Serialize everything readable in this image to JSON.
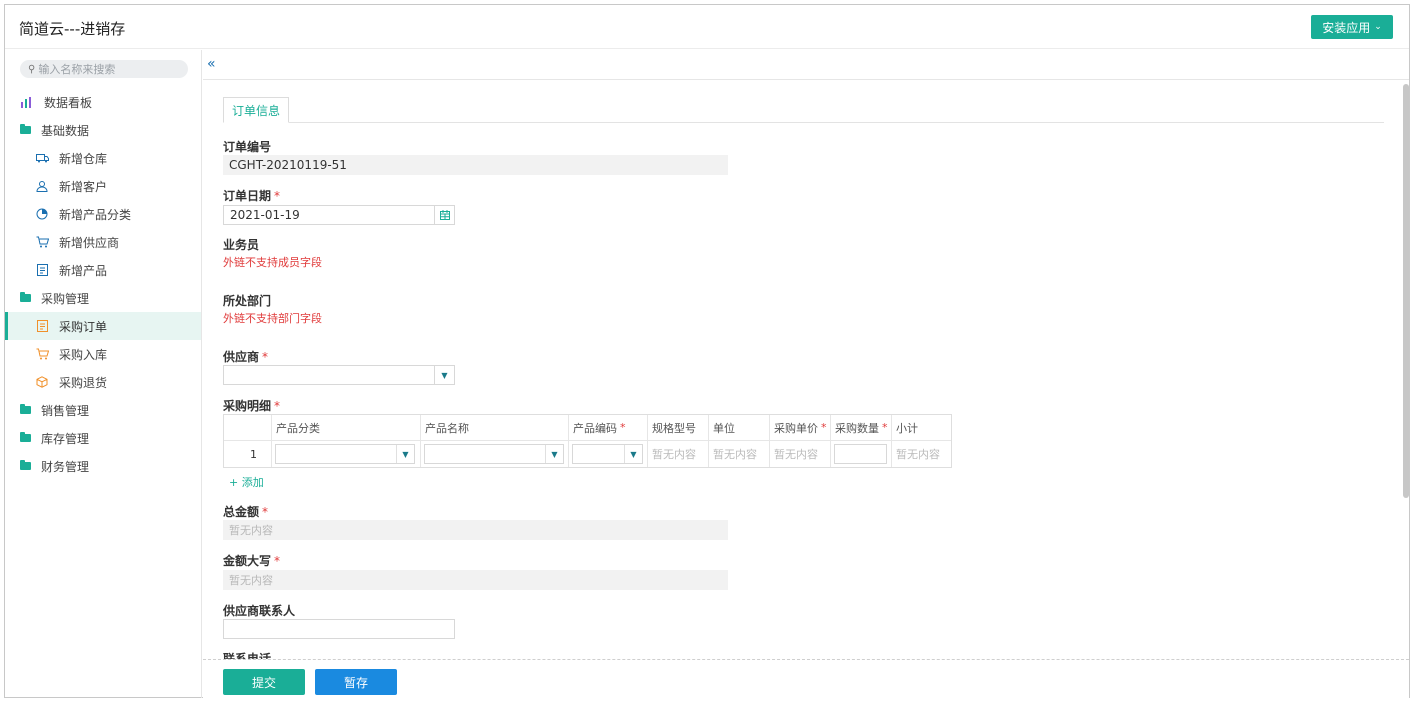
{
  "header": {
    "title": "简道云---进销存",
    "install_label": "安装应用"
  },
  "sidebar": {
    "search_placeholder": "输入名称来搜索",
    "items": [
      {
        "label": "数据看板",
        "icon": "bar-chart-icon"
      },
      {
        "label": "基础数据",
        "icon": "folder-icon"
      },
      {
        "label": "新增仓库",
        "icon": "truck-icon"
      },
      {
        "label": "新增客户",
        "icon": "user-icon"
      },
      {
        "label": "新增产品分类",
        "icon": "pie-chart-icon"
      },
      {
        "label": "新增供应商",
        "icon": "cart-icon"
      },
      {
        "label": "新增产品",
        "icon": "document-icon"
      },
      {
        "label": "采购管理",
        "icon": "folder-icon"
      },
      {
        "label": "采购订单",
        "icon": "order-icon",
        "active": true
      },
      {
        "label": "采购入库",
        "icon": "cart-icon"
      },
      {
        "label": "采购退货",
        "icon": "box-icon"
      },
      {
        "label": "销售管理",
        "icon": "folder-icon"
      },
      {
        "label": "库存管理",
        "icon": "folder-icon"
      },
      {
        "label": "财务管理",
        "icon": "folder-icon"
      }
    ]
  },
  "form": {
    "tab_label": "订单信息",
    "order_no": {
      "label": "订单编号",
      "value": "CGHT-20210119-51"
    },
    "order_date": {
      "label": "订单日期",
      "required": "*",
      "value": "2021-01-19"
    },
    "salesperson": {
      "label": "业务员",
      "warning": "外链不支持成员字段"
    },
    "department": {
      "label": "所处部门",
      "warning": "外链不支持部门字段"
    },
    "supplier": {
      "label": "供应商",
      "required": "*",
      "value": ""
    },
    "details": {
      "label": "采购明细",
      "required": "*",
      "columns": [
        "产品分类",
        "产品名称",
        "产品编码",
        "规格型号",
        "单位",
        "采购单价",
        "采购数量",
        "小计"
      ],
      "row_index": "1",
      "empty_text": "暂无内容",
      "add_label": "+ 添加"
    },
    "total": {
      "label": "总金额",
      "required": "*",
      "placeholder": "暂无内容"
    },
    "total_upper": {
      "label": "金额大写",
      "required": "*",
      "placeholder": "暂无内容"
    },
    "contact": {
      "label": "供应商联系人",
      "value": ""
    },
    "phone": {
      "label": "联系电话"
    }
  },
  "footer": {
    "submit_label": "提交",
    "save_label": "暂存"
  },
  "colors": {
    "accent": "#1aae97",
    "save": "#1a8ae0",
    "required": "#e03a3a"
  }
}
